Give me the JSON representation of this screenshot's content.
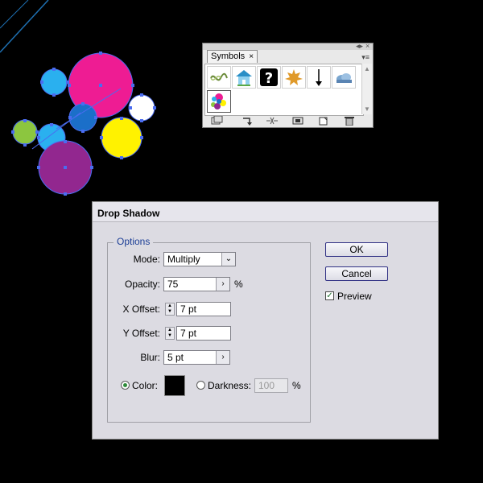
{
  "symbols_panel": {
    "tab_label": "Symbols",
    "tab_close": "×",
    "close_glyph": "×",
    "collapse_glyph": "◂▸",
    "menu_glyph": "▾≡",
    "symbols": [
      {
        "name": "rope-knot-icon"
      },
      {
        "name": "house-icon"
      },
      {
        "name": "question-mark-icon"
      },
      {
        "name": "maple-leaf-icon"
      },
      {
        "name": "down-arrow-icon"
      },
      {
        "name": "cloud-icon"
      },
      {
        "name": "colored-circles-icon"
      }
    ],
    "footer_icons": [
      "library-menu-icon",
      "place-symbol-icon",
      "break-link-icon",
      "symbol-options-icon",
      "new-symbol-icon",
      "delete-symbol-icon"
    ]
  },
  "dialog": {
    "title": "Drop Shadow",
    "options_label": "Options",
    "mode": {
      "label": "Mode:",
      "value": "Multiply",
      "arrow": "⌄"
    },
    "opacity": {
      "label": "Opacity:",
      "value": "75",
      "unit": "%",
      "arrow": "›"
    },
    "x_offset": {
      "label": "X Offset:",
      "value": "7 pt"
    },
    "y_offset": {
      "label": "Y Offset:",
      "value": "7 pt"
    },
    "blur": {
      "label": "Blur:",
      "value": "5 pt",
      "arrow": "›"
    },
    "color": {
      "label": "Color:",
      "selected": true,
      "swatch": "#000000"
    },
    "darkness": {
      "label": "Darkness:",
      "value": "100",
      "unit": "%",
      "selected": false
    },
    "ok_label": "OK",
    "cancel_label": "Cancel",
    "preview": {
      "label": "Preview",
      "checked": true,
      "check_glyph": "✓"
    }
  },
  "colors": {
    "magenta": "#ee1c93",
    "cyan": "#2ab0ef",
    "blue": "#1b6fc9",
    "yellow": "#fff200",
    "green": "#8cc63f",
    "purple": "#92278f",
    "selection": "#4a6cf0"
  }
}
